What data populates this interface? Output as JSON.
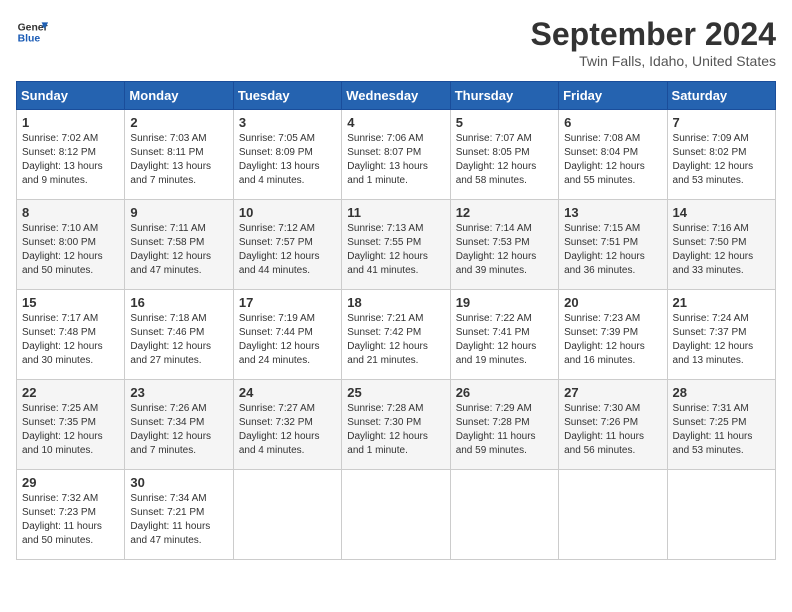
{
  "header": {
    "logo_line1": "General",
    "logo_line2": "Blue",
    "month": "September 2024",
    "location": "Twin Falls, Idaho, United States"
  },
  "weekdays": [
    "Sunday",
    "Monday",
    "Tuesday",
    "Wednesday",
    "Thursday",
    "Friday",
    "Saturday"
  ],
  "weeks": [
    [
      {
        "day": "1",
        "info": "Sunrise: 7:02 AM\nSunset: 8:12 PM\nDaylight: 13 hours\nand 9 minutes."
      },
      {
        "day": "2",
        "info": "Sunrise: 7:03 AM\nSunset: 8:11 PM\nDaylight: 13 hours\nand 7 minutes."
      },
      {
        "day": "3",
        "info": "Sunrise: 7:05 AM\nSunset: 8:09 PM\nDaylight: 13 hours\nand 4 minutes."
      },
      {
        "day": "4",
        "info": "Sunrise: 7:06 AM\nSunset: 8:07 PM\nDaylight: 13 hours\nand 1 minute."
      },
      {
        "day": "5",
        "info": "Sunrise: 7:07 AM\nSunset: 8:05 PM\nDaylight: 12 hours\nand 58 minutes."
      },
      {
        "day": "6",
        "info": "Sunrise: 7:08 AM\nSunset: 8:04 PM\nDaylight: 12 hours\nand 55 minutes."
      },
      {
        "day": "7",
        "info": "Sunrise: 7:09 AM\nSunset: 8:02 PM\nDaylight: 12 hours\nand 53 minutes."
      }
    ],
    [
      {
        "day": "8",
        "info": "Sunrise: 7:10 AM\nSunset: 8:00 PM\nDaylight: 12 hours\nand 50 minutes."
      },
      {
        "day": "9",
        "info": "Sunrise: 7:11 AM\nSunset: 7:58 PM\nDaylight: 12 hours\nand 47 minutes."
      },
      {
        "day": "10",
        "info": "Sunrise: 7:12 AM\nSunset: 7:57 PM\nDaylight: 12 hours\nand 44 minutes."
      },
      {
        "day": "11",
        "info": "Sunrise: 7:13 AM\nSunset: 7:55 PM\nDaylight: 12 hours\nand 41 minutes."
      },
      {
        "day": "12",
        "info": "Sunrise: 7:14 AM\nSunset: 7:53 PM\nDaylight: 12 hours\nand 39 minutes."
      },
      {
        "day": "13",
        "info": "Sunrise: 7:15 AM\nSunset: 7:51 PM\nDaylight: 12 hours\nand 36 minutes."
      },
      {
        "day": "14",
        "info": "Sunrise: 7:16 AM\nSunset: 7:50 PM\nDaylight: 12 hours\nand 33 minutes."
      }
    ],
    [
      {
        "day": "15",
        "info": "Sunrise: 7:17 AM\nSunset: 7:48 PM\nDaylight: 12 hours\nand 30 minutes."
      },
      {
        "day": "16",
        "info": "Sunrise: 7:18 AM\nSunset: 7:46 PM\nDaylight: 12 hours\nand 27 minutes."
      },
      {
        "day": "17",
        "info": "Sunrise: 7:19 AM\nSunset: 7:44 PM\nDaylight: 12 hours\nand 24 minutes."
      },
      {
        "day": "18",
        "info": "Sunrise: 7:21 AM\nSunset: 7:42 PM\nDaylight: 12 hours\nand 21 minutes."
      },
      {
        "day": "19",
        "info": "Sunrise: 7:22 AM\nSunset: 7:41 PM\nDaylight: 12 hours\nand 19 minutes."
      },
      {
        "day": "20",
        "info": "Sunrise: 7:23 AM\nSunset: 7:39 PM\nDaylight: 12 hours\nand 16 minutes."
      },
      {
        "day": "21",
        "info": "Sunrise: 7:24 AM\nSunset: 7:37 PM\nDaylight: 12 hours\nand 13 minutes."
      }
    ],
    [
      {
        "day": "22",
        "info": "Sunrise: 7:25 AM\nSunset: 7:35 PM\nDaylight: 12 hours\nand 10 minutes."
      },
      {
        "day": "23",
        "info": "Sunrise: 7:26 AM\nSunset: 7:34 PM\nDaylight: 12 hours\nand 7 minutes."
      },
      {
        "day": "24",
        "info": "Sunrise: 7:27 AM\nSunset: 7:32 PM\nDaylight: 12 hours\nand 4 minutes."
      },
      {
        "day": "25",
        "info": "Sunrise: 7:28 AM\nSunset: 7:30 PM\nDaylight: 12 hours\nand 1 minute."
      },
      {
        "day": "26",
        "info": "Sunrise: 7:29 AM\nSunset: 7:28 PM\nDaylight: 11 hours\nand 59 minutes."
      },
      {
        "day": "27",
        "info": "Sunrise: 7:30 AM\nSunset: 7:26 PM\nDaylight: 11 hours\nand 56 minutes."
      },
      {
        "day": "28",
        "info": "Sunrise: 7:31 AM\nSunset: 7:25 PM\nDaylight: 11 hours\nand 53 minutes."
      }
    ],
    [
      {
        "day": "29",
        "info": "Sunrise: 7:32 AM\nSunset: 7:23 PM\nDaylight: 11 hours\nand 50 minutes."
      },
      {
        "day": "30",
        "info": "Sunrise: 7:34 AM\nSunset: 7:21 PM\nDaylight: 11 hours\nand 47 minutes."
      },
      {
        "day": "",
        "info": ""
      },
      {
        "day": "",
        "info": ""
      },
      {
        "day": "",
        "info": ""
      },
      {
        "day": "",
        "info": ""
      },
      {
        "day": "",
        "info": ""
      }
    ]
  ]
}
